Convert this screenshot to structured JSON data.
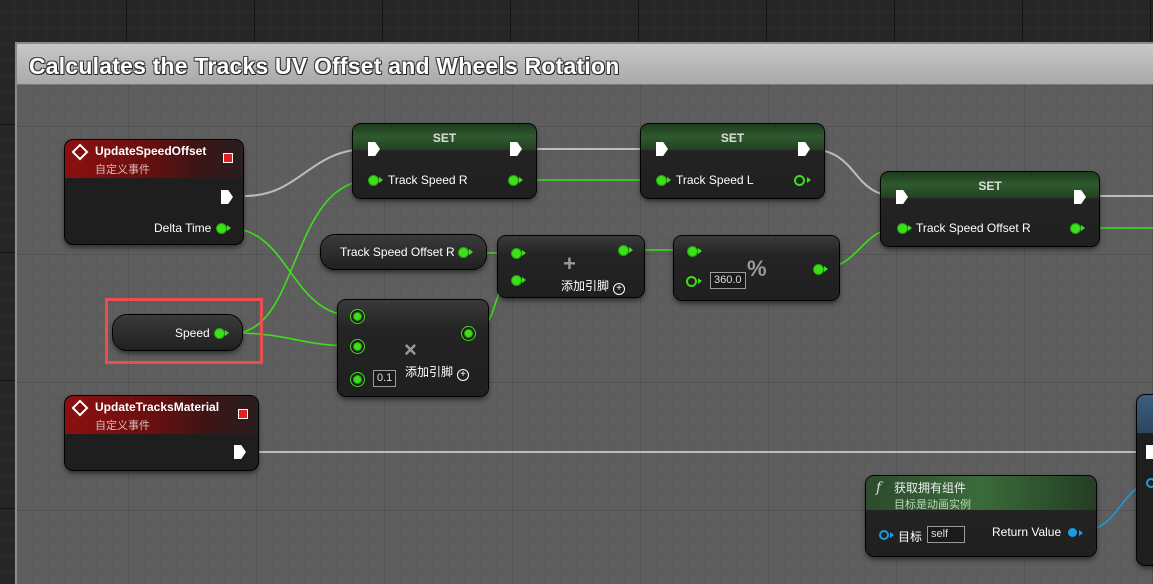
{
  "comment": {
    "title": "Calculates the Tracks UV Offset and Wheels Rotation"
  },
  "nodes": {
    "update_speed_offset": {
      "title": "UpdateSpeedOffset",
      "subtitle": "自定义事件",
      "pin_delta_time": "Delta Time"
    },
    "set1": {
      "title": "SET",
      "pin": "Track Speed R"
    },
    "set2": {
      "title": "SET",
      "pin": "Track Speed L"
    },
    "set3": {
      "title": "SET",
      "pin": "Track Speed Offset R"
    },
    "get_track_speed_offset_r": {
      "label": "Track Speed Offset R"
    },
    "add": {
      "symbol": "+",
      "add_pin": "添加引脚"
    },
    "modulo": {
      "symbol": "%",
      "value": "360.0"
    },
    "speed": {
      "label": "Speed"
    },
    "multiply": {
      "symbol": "×",
      "value": "0.1",
      "add_pin": "添加引脚"
    },
    "update_tracks_material": {
      "title": "UpdateTracksMaterial",
      "subtitle": "自定义事件"
    },
    "get_owning_component": {
      "icon": "function-icon",
      "title": "获取拥有组件",
      "subtitle": "目标是动画实例",
      "pin_target": "目标",
      "target_value": "self",
      "pin_return": "Return Value"
    }
  },
  "colors": {
    "float_pin": "#3be01a",
    "object_pin": "#1a9de0",
    "event_header": "#8c1010",
    "highlight": "#e85050"
  }
}
